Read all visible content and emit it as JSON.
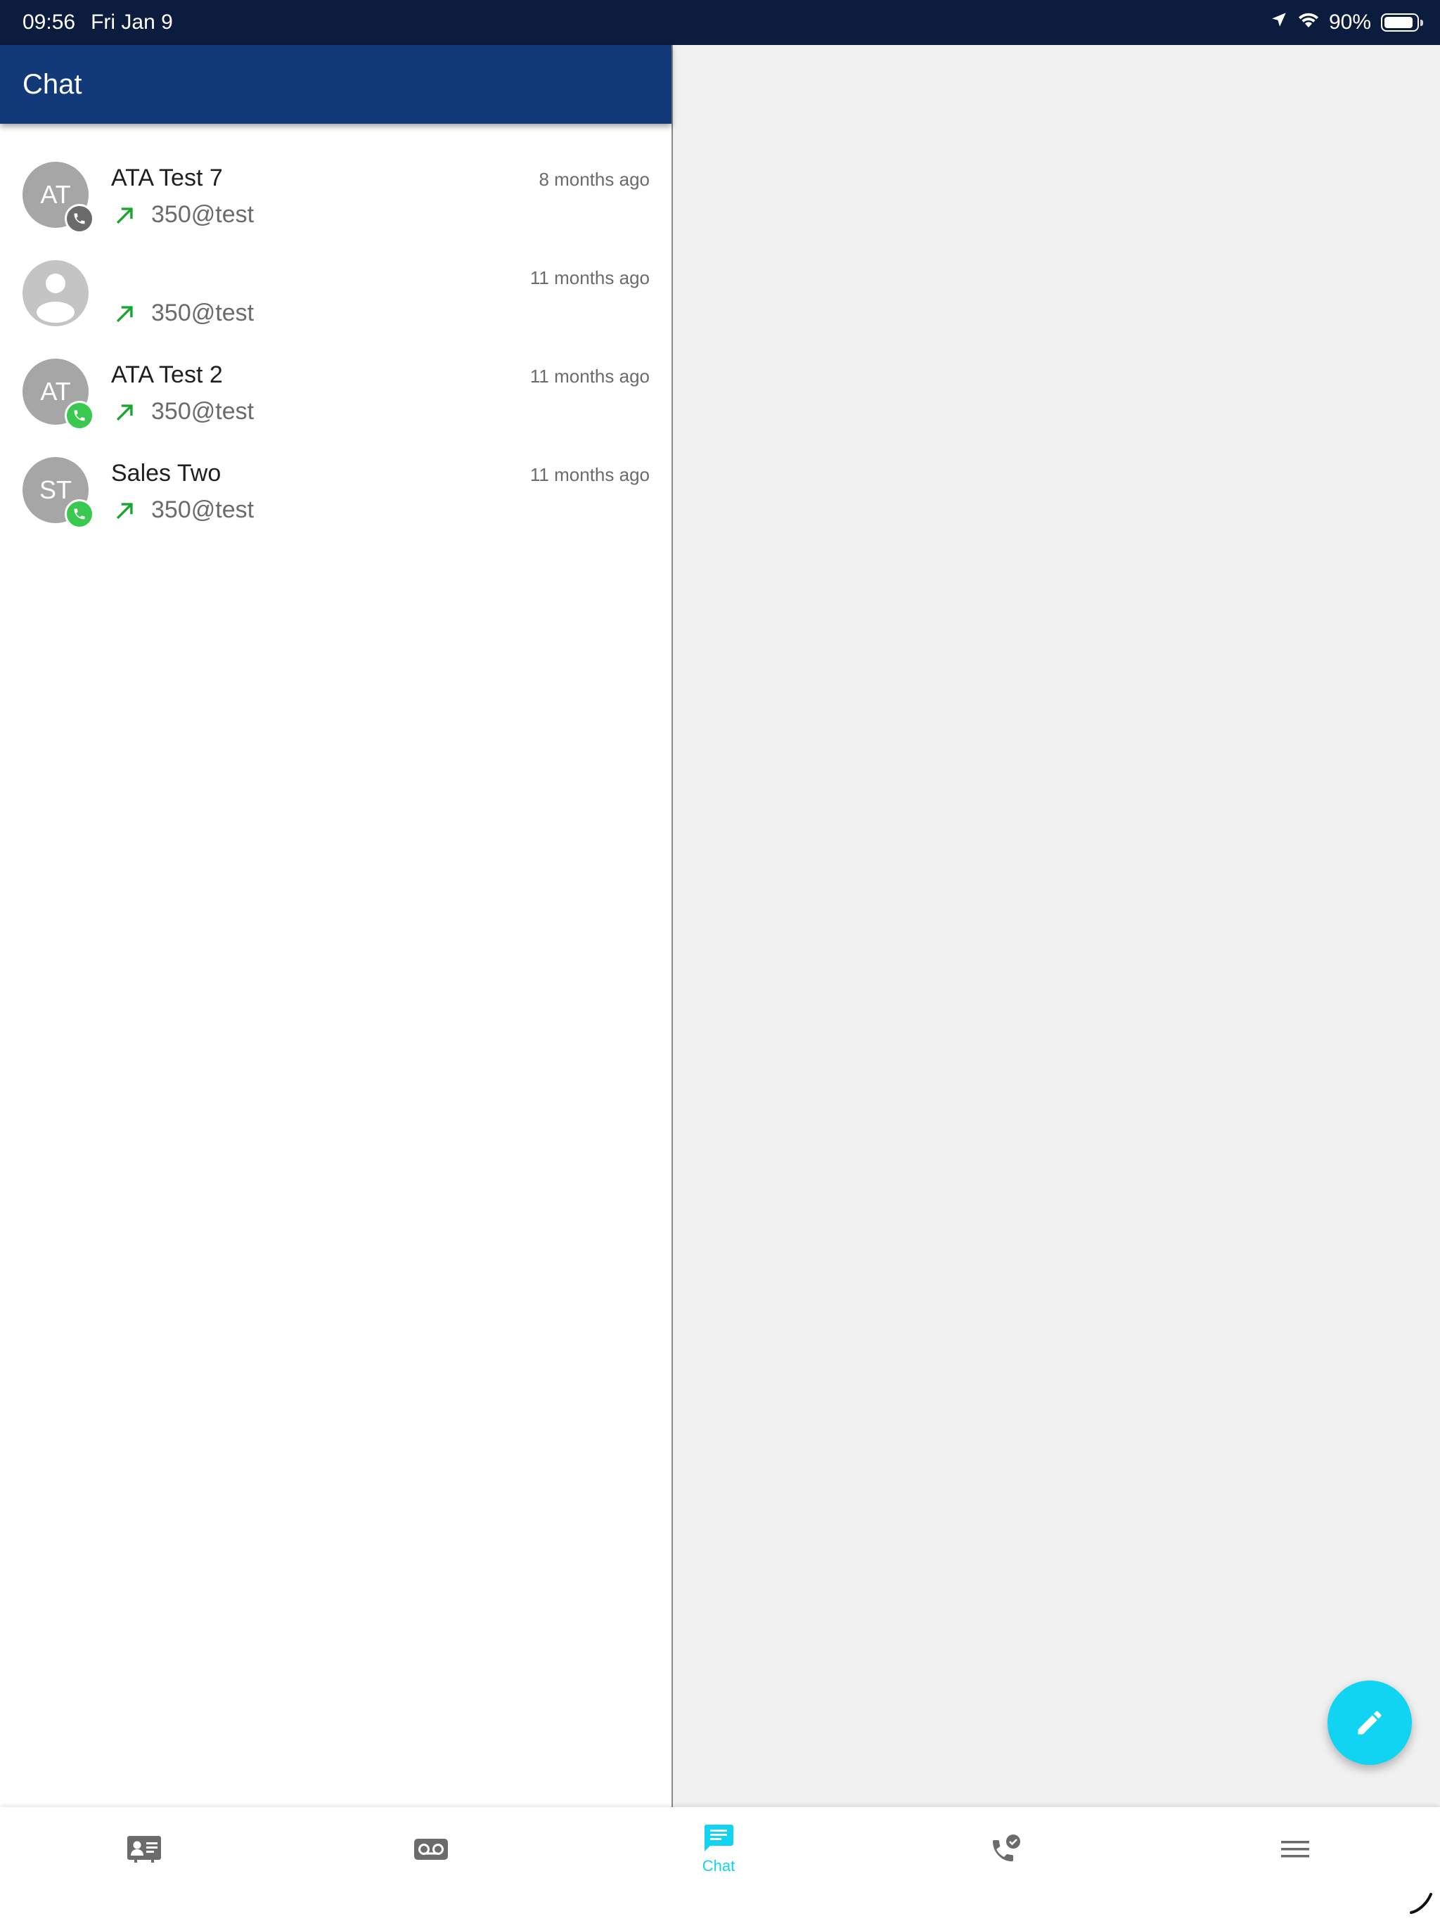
{
  "status_bar": {
    "time": "09:56",
    "date": "Fri Jan 9",
    "battery_percent": "90%",
    "battery_level": 0.9,
    "icons": [
      "location-arrow-icon",
      "wifi-icon",
      "battery-icon"
    ]
  },
  "header": {
    "title": "Chat"
  },
  "conversations": [
    {
      "name": "ATA Test 7",
      "initials": "AT",
      "time": "8 months ago",
      "preview": "350@test",
      "direction": "outgoing",
      "presence_icon": "phone-icon",
      "presence_color": "#6b6b6b"
    },
    {
      "name": "",
      "initials": "",
      "time": "11 months ago",
      "preview": "350@test",
      "direction": "outgoing",
      "presence_icon": "",
      "presence_color": ""
    },
    {
      "name": "ATA Test 2",
      "initials": "AT",
      "time": "11 months ago",
      "preview": "350@test",
      "direction": "outgoing",
      "presence_icon": "phone-icon",
      "presence_color": "#39c94f"
    },
    {
      "name": "Sales Two",
      "initials": "ST",
      "time": "11 months ago",
      "preview": "350@test",
      "direction": "outgoing",
      "presence_icon": "phone-icon",
      "presence_color": "#39c94f"
    }
  ],
  "fab": {
    "icon": "pencil-icon"
  },
  "bottom_nav": {
    "items": [
      {
        "id": "contacts",
        "icon": "contact-card-icon",
        "label": "",
        "active": false
      },
      {
        "id": "voicemail",
        "icon": "voicemail-icon",
        "label": "",
        "active": false
      },
      {
        "id": "chat",
        "icon": "chat-bubble-icon",
        "label": "Chat",
        "active": true
      },
      {
        "id": "calls",
        "icon": "call-history-icon",
        "label": "",
        "active": false
      },
      {
        "id": "menu",
        "icon": "menu-icon",
        "label": "",
        "active": false
      }
    ]
  },
  "colors": {
    "status_bar": "#0c1c3e",
    "header": "#133a78",
    "accent": "#11d4f2",
    "outgoing_arrow": "#1aa62d",
    "online": "#39c94f",
    "offline": "#6b6b6b",
    "right_pane": "#f1f1f1"
  }
}
